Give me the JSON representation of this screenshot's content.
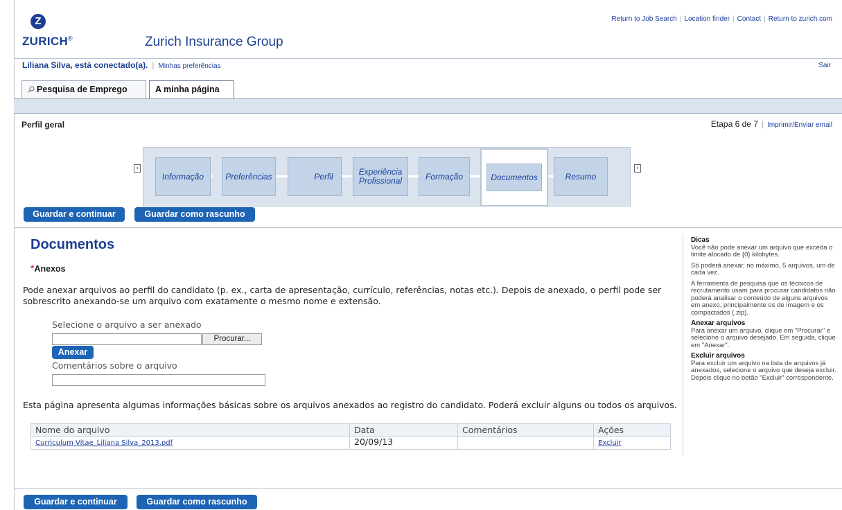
{
  "brand": {
    "logo_letter": "Z",
    "logo_word": "ZURICH",
    "logo_reg": "®",
    "title": "Zurich Insurance Group"
  },
  "top_links": [
    "Return to Job Search",
    "Location finder",
    "Contact",
    "Return to zurich.com"
  ],
  "user": {
    "name": "Liliana Silva, está conectado(a).",
    "preferences": "Minhas preferências",
    "logout": "Sair"
  },
  "tabs": [
    {
      "label": "Pesquisa de Emprego",
      "icon": "search-icon"
    },
    {
      "label": "A minha página"
    }
  ],
  "profile": {
    "title": "Perfil geral",
    "step_text": "Etapa 6 de 7",
    "print_link": "Imprimir/Enviar email"
  },
  "steps": [
    "Informação",
    "Preferências",
    "Perfil",
    "Experiência Profissional",
    "Formação",
    "Documentos",
    "Resumo"
  ],
  "active_step": "Documentos",
  "nav_arrows": {
    "prev": "‹",
    "next": "›"
  },
  "buttons": {
    "save_continue": "Guardar e continuar",
    "save_draft": "Guardar como rascunho",
    "attach": "Anexar",
    "browse": "Procurar..."
  },
  "documents": {
    "title": "Documentos",
    "required_mark": "*",
    "section": "Anexos",
    "intro": "Pode anexar arquivos ao perfil do candidato (p. ex., carta de apresentação, currículo, referências, notas etc.). Depois de anexado, o perfil pode ser sobrescrito anexando-se um arquivo com exatamente o mesmo nome e extensão.",
    "select_label": "Selecione o arquivo a ser anexado",
    "comments_label": "Comentários sobre o arquivo",
    "file_value": "",
    "comments_value": "",
    "info": "Esta página apresenta algumas informações básicas sobre os arquivos anexados ao registro do candidato. Poderá excluir alguns ou todos os arquivos."
  },
  "table": {
    "headers": [
      "Nome do arquivo",
      "Data",
      "Comentários",
      "Ações"
    ],
    "rows": [
      {
        "file": "Curriculum Vitae_Liliana Silva_2013.pdf",
        "date": "20/09/13",
        "comments": "",
        "action": "Excluir"
      }
    ]
  },
  "tips": {
    "title": "Dicas",
    "p1": "Você não pode anexar um arquivo que exceda o limite alocado de {0} kilobytes.",
    "p2": "Só poderá anexar, no máximo, 5 arquivos, um de cada vez.",
    "p3": "A ferramenta de pesquisa que os técnicos de recrutamento usam para procurar candidatos não poderá analisar o conteúdo de alguns arquivos em anexo, principalmente os de imagem e os compactados (.zip).",
    "attach_title": "Anexar arquivos",
    "attach_text": "Para anexar um arquivo, clique em \"Procurar\" e selecione o arquivo desejado. Em seguida, clique em \"Anexar\".",
    "delete_title": "Excluir arquivos",
    "delete_text": "Para excluir um arquivo na lista de arquivos já anexados, selecione o arquivo que deseja excluir. Depois clique no botão \"Excluir\" correspondente."
  },
  "colors": {
    "brand_blue": "#1c3f94",
    "button_blue": "#1e64b4",
    "step_fill": "#c3d4e9",
    "bar_fill": "#dbe3ee"
  }
}
